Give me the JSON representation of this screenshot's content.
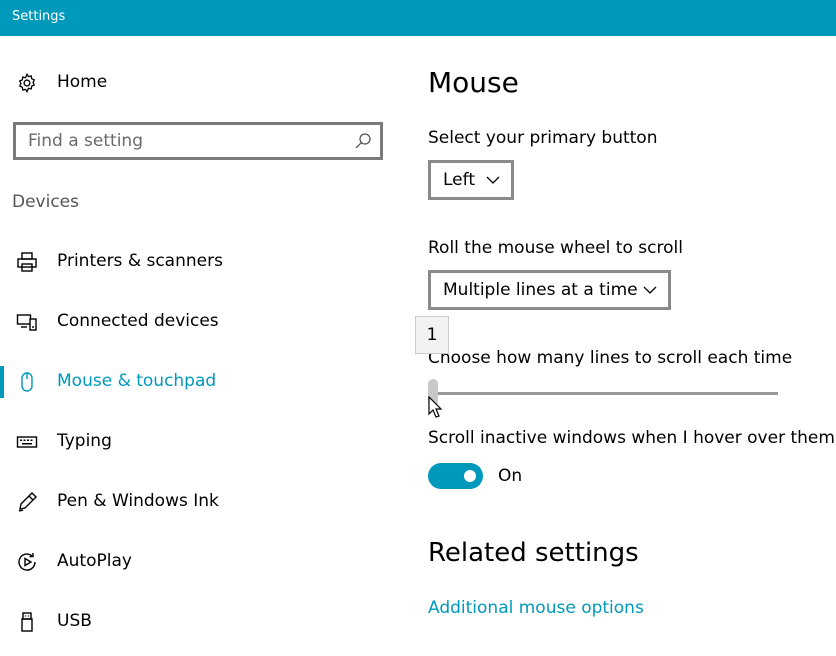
{
  "window": {
    "title": "Settings"
  },
  "sidebar": {
    "home_label": "Home",
    "search": {
      "placeholder": "Find a setting"
    },
    "section": "Devices",
    "items": [
      {
        "label": "Printers & scanners",
        "icon": "printer-icon"
      },
      {
        "label": "Connected devices",
        "icon": "connected-devices-icon"
      },
      {
        "label": "Mouse & touchpad",
        "icon": "mouse-icon",
        "selected": true
      },
      {
        "label": "Typing",
        "icon": "keyboard-icon"
      },
      {
        "label": "Pen & Windows Ink",
        "icon": "pen-icon"
      },
      {
        "label": "AutoPlay",
        "icon": "autoplay-icon"
      },
      {
        "label": "USB",
        "icon": "usb-icon"
      }
    ]
  },
  "main": {
    "title": "Mouse",
    "primary_button": {
      "label": "Select your primary button",
      "value": "Left"
    },
    "scroll_mode": {
      "label": "Roll the mouse wheel to scroll",
      "value": "Multiple lines at a time"
    },
    "lines": {
      "label": "Choose how many lines to scroll each time",
      "tooltip_value": "1",
      "value": 1
    },
    "inactive_scroll": {
      "label": "Scroll inactive windows when I hover over them",
      "state": "On",
      "enabled": true
    },
    "related": {
      "title": "Related settings",
      "link": "Additional mouse options"
    }
  },
  "colors": {
    "accent": "#0099bc",
    "text": "#000000",
    "border": "#8a8a8a"
  }
}
